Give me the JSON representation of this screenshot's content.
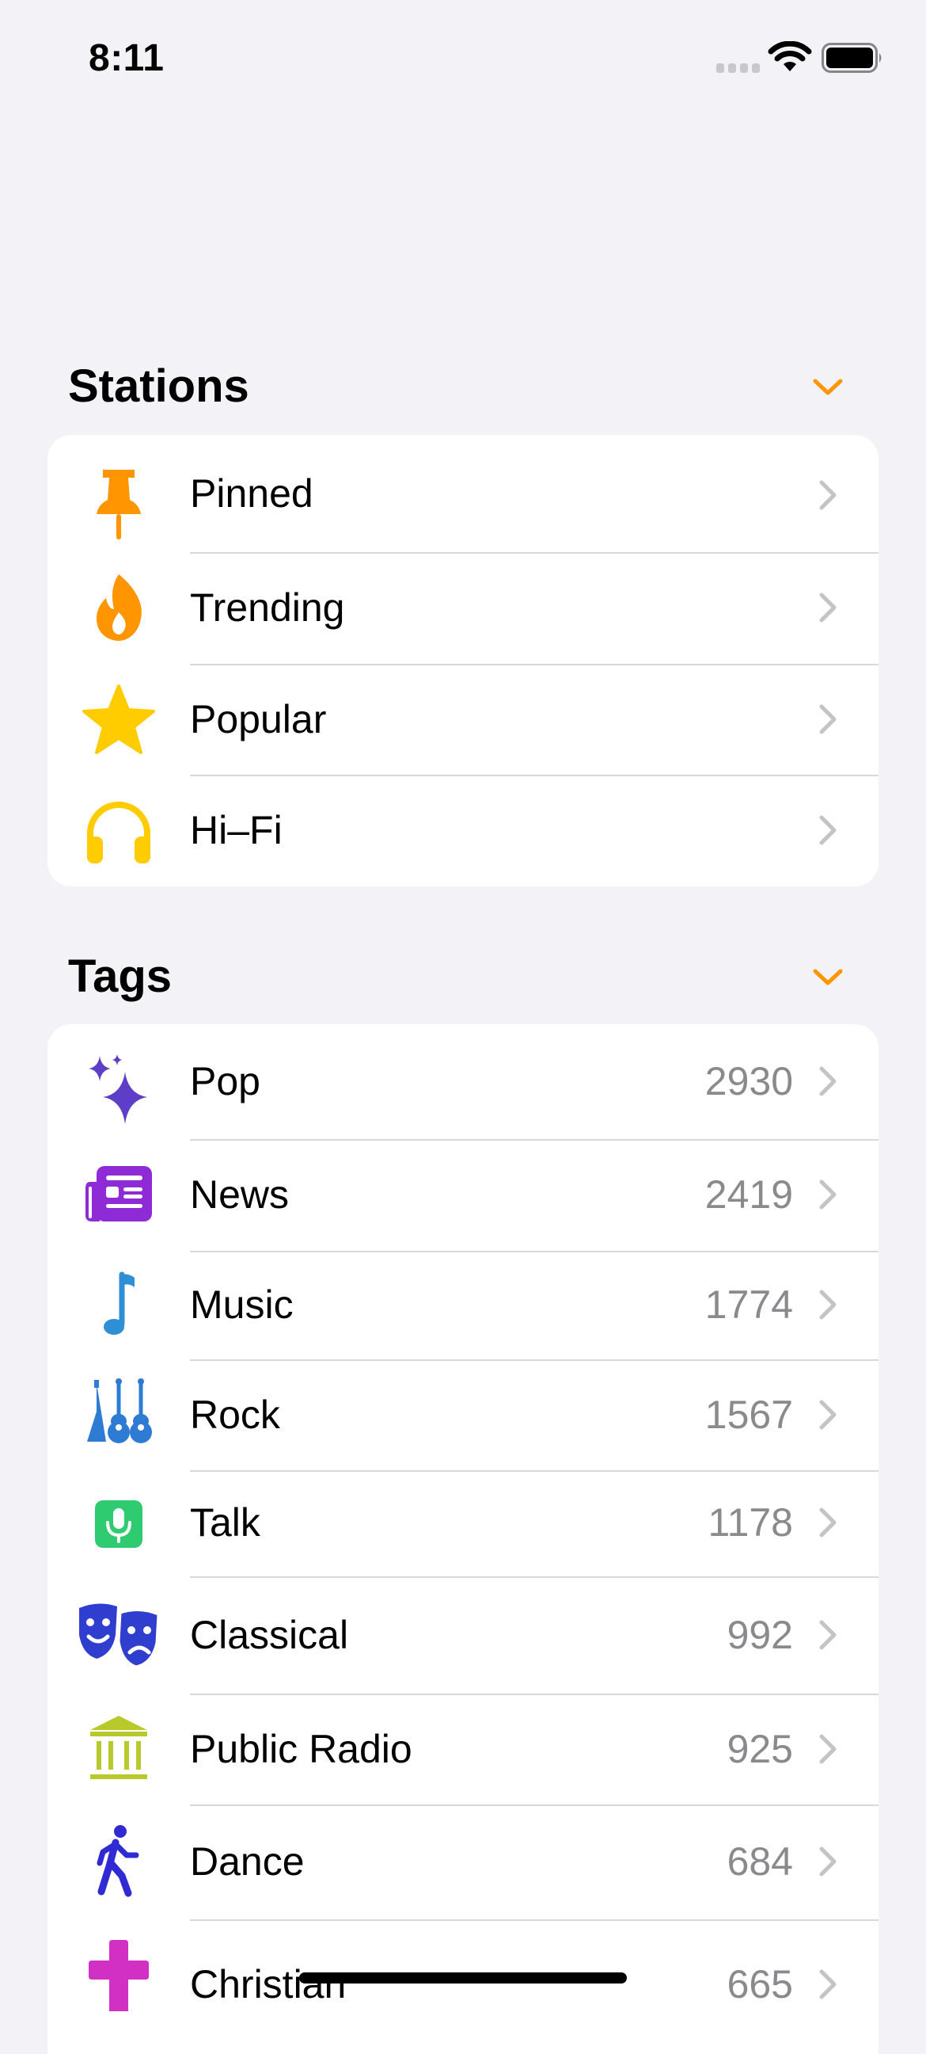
{
  "status_bar": {
    "time": "8:11",
    "icons": [
      "cellular-signal-icon",
      "wifi-icon",
      "battery-icon"
    ]
  },
  "colors": {
    "accent": "#ff9500",
    "background": "#f2f2f7",
    "card": "#ffffff",
    "secondary_text": "#8a8a8e",
    "chevron": "#c4c4c7"
  },
  "stations": {
    "title": "Stations",
    "items": [
      {
        "label": "Pinned",
        "icon": "pin-icon"
      },
      {
        "label": "Trending",
        "icon": "flame-icon"
      },
      {
        "label": "Popular",
        "icon": "star-icon"
      },
      {
        "label": "Hi–Fi",
        "icon": "headphones-icon"
      }
    ]
  },
  "tags": {
    "title": "Tags",
    "items": [
      {
        "label": "Pop",
        "count": "2930",
        "icon": "sparkles-icon"
      },
      {
        "label": "News",
        "count": "2419",
        "icon": "newspaper-icon"
      },
      {
        "label": "Music",
        "count": "1774",
        "icon": "music-note-icon"
      },
      {
        "label": "Rock",
        "count": "1567",
        "icon": "guitars-icon"
      },
      {
        "label": "Talk",
        "count": "1178",
        "icon": "microphone-icon"
      },
      {
        "label": "Classical",
        "count": "992",
        "icon": "theater-masks-icon"
      },
      {
        "label": "Public Radio",
        "count": "925",
        "icon": "building-columns-icon"
      },
      {
        "label": "Dance",
        "count": "684",
        "icon": "figure-walk-icon"
      },
      {
        "label": "Christian",
        "count": "665",
        "icon": "cross-icon"
      }
    ]
  }
}
